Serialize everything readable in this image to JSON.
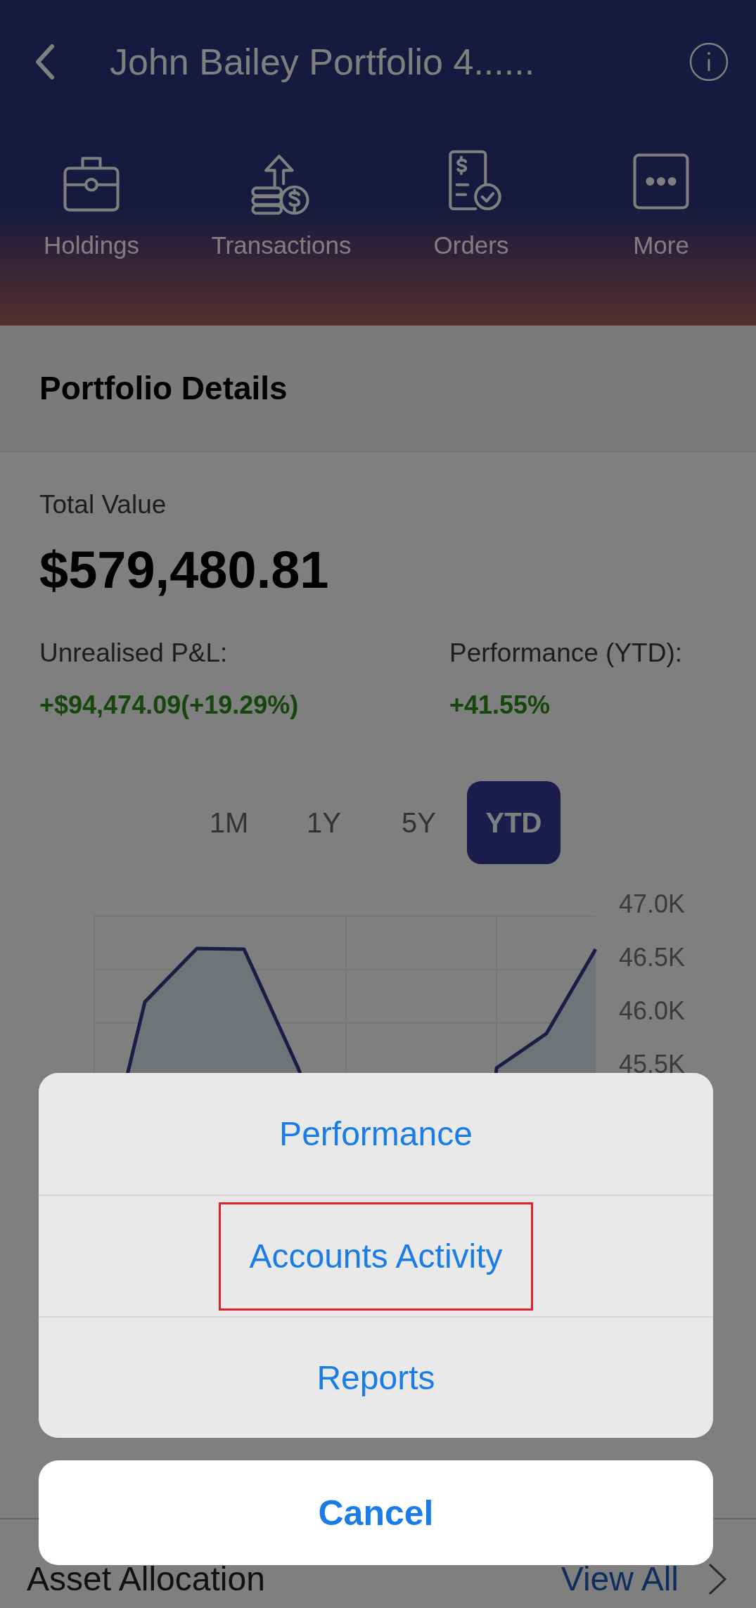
{
  "header": {
    "title": "John Bailey Portfolio 4......",
    "nav": [
      {
        "label": "Holdings",
        "kind": "briefcase"
      },
      {
        "label": "Transactions",
        "kind": "coins"
      },
      {
        "label": "Orders",
        "kind": "receipt"
      },
      {
        "label": "More",
        "kind": "more"
      }
    ]
  },
  "section": {
    "title": "Portfolio Details"
  },
  "summary": {
    "total_label": "Total Value",
    "total_value": "$579,480.81",
    "metrics": [
      {
        "label": "Unrealised P&L:",
        "value": "+$94,474.09(+19.29%)"
      },
      {
        "label": "Performance (YTD):",
        "value": "+41.55%"
      }
    ]
  },
  "ranges": [
    {
      "label": "1M",
      "selected": false
    },
    {
      "label": "1Y",
      "selected": false
    },
    {
      "label": "5Y",
      "selected": false
    },
    {
      "label": "YTD",
      "selected": true
    }
  ],
  "chart": {
    "axis_labels": [
      "47.0K",
      "46.5K",
      "46.0K",
      "45.5K"
    ]
  },
  "footer": {
    "title": "Asset Allocation",
    "link": "View All"
  },
  "action_sheet": {
    "items": [
      {
        "label": "Performance",
        "highlighted": false
      },
      {
        "label": "Accounts Activity",
        "highlighted": true
      },
      {
        "label": "Reports",
        "highlighted": false
      }
    ],
    "cancel": "Cancel"
  }
}
